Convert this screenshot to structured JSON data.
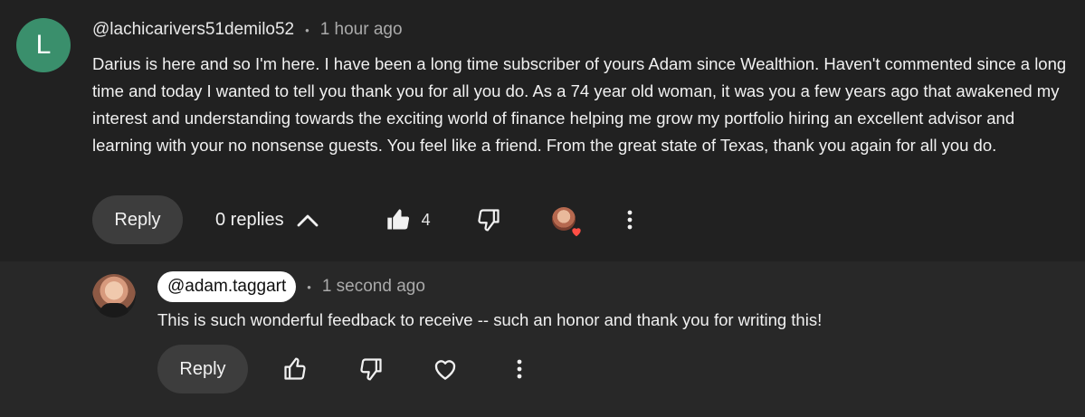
{
  "comment": {
    "avatar_letter": "L",
    "author": "@lachicarivers51demilo52",
    "separator": "•",
    "time": "1 hour ago",
    "text": "Darius is here and so I'm here. I have been a long time subscriber of yours Adam since Wealthion. Haven't commented since a long time and today I wanted to tell you thank you for all you do. As a 74 year old woman, it was you a few years ago that awakened my interest and understanding towards the exciting world of finance helping me grow my portfolio hiring an excellent advisor and learning with your no nonsense guests. You feel like a friend. From the great state of Texas, thank you again for all you do.",
    "reply_label": "Reply",
    "replies_label": "0 replies",
    "like_count": "4",
    "hearted_by_creator": true
  },
  "reply": {
    "author": "@adam.taggart",
    "separator": "•",
    "time": "1 second ago",
    "text": "This is such wonderful feedback to receive -- such an honor and thank you for writing this!",
    "reply_label": "Reply"
  },
  "colors": {
    "background": "#212121",
    "reply_background": "#282828",
    "avatar_l": "#3a8f6c",
    "heart": "#ff4e45",
    "button": "#3d3d3d"
  },
  "icons": {
    "like": "thumbs-up-filled-icon",
    "dislike": "thumbs-down-icon",
    "collapse": "chevron-up-icon",
    "more": "more-vert-icon",
    "heart": "heart-outline-icon"
  }
}
